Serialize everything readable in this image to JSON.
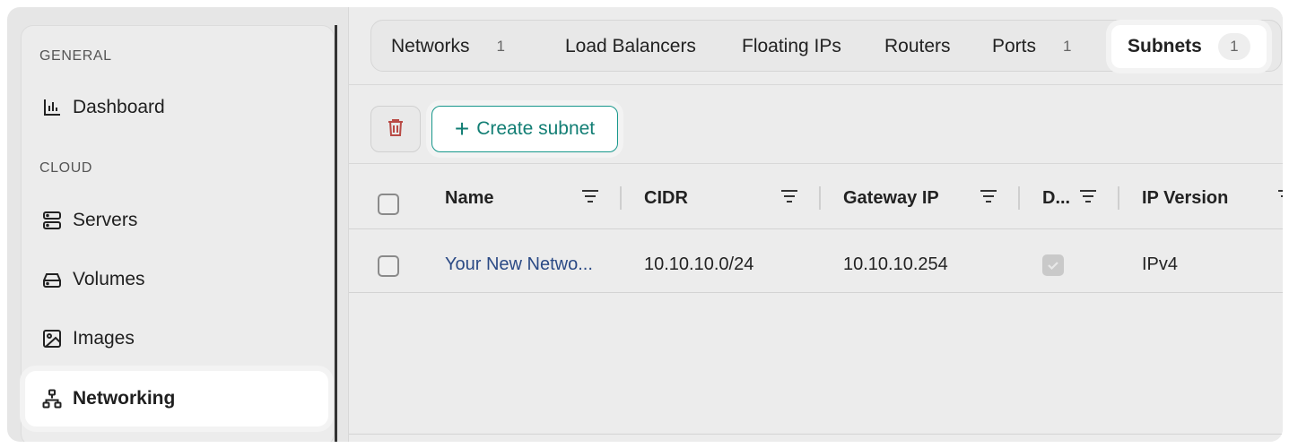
{
  "sidebar": {
    "sections": [
      {
        "label": "GENERAL"
      },
      {
        "label": "CLOUD"
      }
    ],
    "items": [
      {
        "label": "Dashboard",
        "icon": "bar-chart-icon"
      },
      {
        "label": "Servers",
        "icon": "server-icon"
      },
      {
        "label": "Volumes",
        "icon": "drive-icon"
      },
      {
        "label": "Images",
        "icon": "image-icon"
      },
      {
        "label": "Networking",
        "icon": "network-icon",
        "active": true
      }
    ]
  },
  "tabs": [
    {
      "label": "Networks",
      "count": "1"
    },
    {
      "label": "Load Balancers"
    },
    {
      "label": "Floating IPs"
    },
    {
      "label": "Routers"
    },
    {
      "label": "Ports",
      "count": "1"
    },
    {
      "label": "Subnets",
      "count": "1",
      "active": true
    }
  ],
  "toolbar": {
    "delete_icon": "trash-icon",
    "create_label": "Create subnet"
  },
  "table": {
    "columns": [
      "Name",
      "CIDR",
      "Gateway IP",
      "D...",
      "IP Version"
    ],
    "rows": [
      {
        "name": "Your New Netwo...",
        "cidr": "10.10.10.0/24",
        "gateway": "10.10.10.254",
        "dhcp": true,
        "ip_version": "IPv4"
      }
    ]
  },
  "colors": {
    "accent": "#127e74",
    "link": "#2b4a85",
    "danger": "#b94a45"
  }
}
